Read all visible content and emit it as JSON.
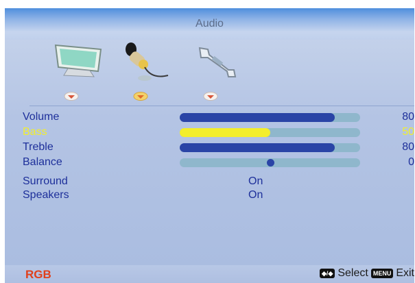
{
  "menu": {
    "title": "Audio"
  },
  "tabs": [
    {
      "icon": "monitor-icon"
    },
    {
      "icon": "microphone-icon"
    },
    {
      "icon": "wrench-icon"
    }
  ],
  "settings": [
    {
      "label": "Volume",
      "level": 0.86,
      "value": "80"
    },
    {
      "label": "Bass",
      "level": 0.5,
      "value": "50",
      "highlight": true
    },
    {
      "label": "Treble",
      "level": 0.86,
      "value": "80"
    },
    {
      "label": "Balance",
      "position": 0.5,
      "value": "0"
    },
    {
      "label": "Surround",
      "value": "On"
    },
    {
      "label": "Speakers",
      "value": "On"
    }
  ],
  "footer": {
    "source": "RGB",
    "select_key": "◆/◆",
    "select_label": "Select",
    "menu_key": "MENU",
    "exit_label": "Exit"
  },
  "colors": {
    "bar_fill": "#2a44a6",
    "bar_highlight": "#f3ee2c",
    "bar_track": "#8fb7cc",
    "label_text": "#1d2f9a",
    "highlight_text": "#f2ee2e",
    "source_text": "#e0401c"
  }
}
